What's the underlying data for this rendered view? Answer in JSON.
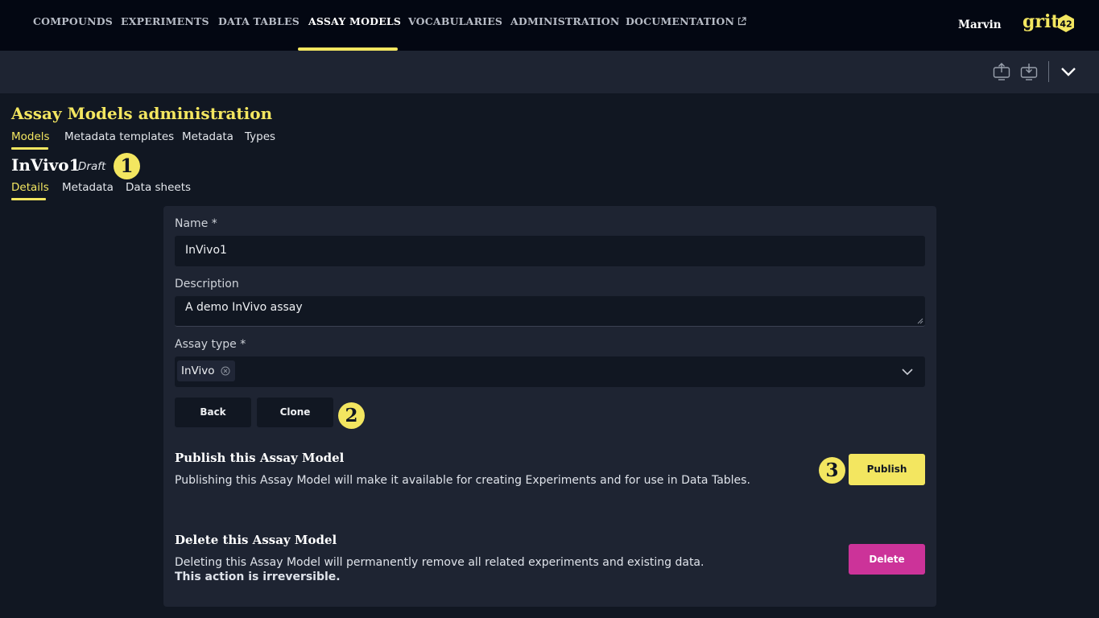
{
  "nav": {
    "items": [
      "COMPOUNDS",
      "EXPERIMENTS",
      "DATA TABLES",
      "ASSAY MODELS",
      "VOCABULARIES",
      "ADMINISTRATION",
      "DOCUMENTATION"
    ],
    "active": "ASSAY MODELS",
    "user": "Marvin",
    "logo_text": "grit",
    "logo_badge": "42"
  },
  "toolbar": {
    "icons": [
      "upload-icon",
      "download-icon",
      "chevron-down-icon"
    ]
  },
  "page": {
    "title": "Assay Models administration",
    "tabs": [
      "Models",
      "Metadata templates",
      "Metadata",
      "Types"
    ],
    "active_tab": "Models"
  },
  "model": {
    "name": "InVivo1",
    "status": "Draft",
    "tabs": [
      "Details",
      "Metadata",
      "Data sheets"
    ],
    "active_tab": "Details"
  },
  "badges": [
    "1",
    "2",
    "3"
  ],
  "form": {
    "name_label": "Name *",
    "name_value": "InVivo1",
    "description_label": "Description",
    "description_value": "A demo InVivo assay",
    "assay_type_label": "Assay type *",
    "assay_type_value": "InVivo",
    "back_label": "Back",
    "clone_label": "Clone"
  },
  "publish": {
    "title": "Publish this Assay Model",
    "text": "Publishing this Assay Model will make it available for creating Experiments and for use in Data Tables.",
    "button": "Publish"
  },
  "delete": {
    "title": "Delete this Assay Model",
    "text": "Deleting this Assay Model will permanently remove all related experiments and existing data.",
    "text_bold": "This action is irreversible.",
    "button": "Delete"
  },
  "colors": {
    "accent": "#f3e660",
    "delete": "#cc3399",
    "background": "#111722",
    "panel": "#1e2432",
    "nav": "#030712"
  }
}
